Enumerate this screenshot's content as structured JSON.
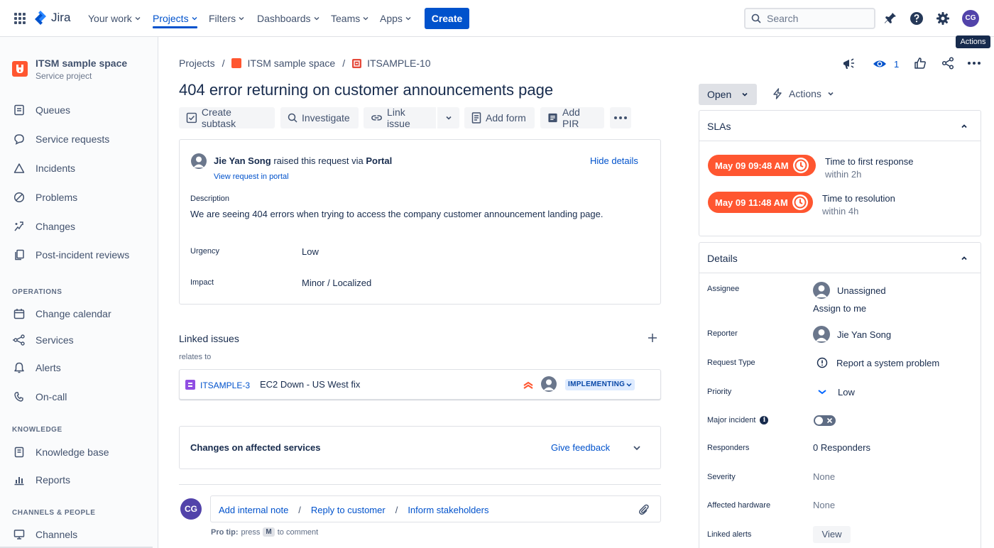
{
  "nav": {
    "app_name": "Jira",
    "items": [
      {
        "label": "Your work"
      },
      {
        "label": "Projects"
      },
      {
        "label": "Filters"
      },
      {
        "label": "Dashboards"
      },
      {
        "label": "Teams"
      },
      {
        "label": "Apps"
      }
    ],
    "create_label": "Create",
    "search_placeholder": "Search",
    "avatar_initials": "CG",
    "tooltip": "Actions"
  },
  "sidebar": {
    "project_name": "ITSM sample space",
    "project_type": "Service project",
    "items": [
      {
        "label": "Queues",
        "icon": "queues-icon"
      },
      {
        "label": "Service requests",
        "icon": "chat-icon"
      },
      {
        "label": "Incidents",
        "icon": "warning-triangle-icon"
      },
      {
        "label": "Problems",
        "icon": "blocked-icon"
      },
      {
        "label": "Changes",
        "icon": "changes-icon"
      },
      {
        "label": "Post-incident reviews",
        "icon": "copy-icon"
      }
    ],
    "section_operations": "OPERATIONS",
    "operations_items": [
      {
        "label": "Change calendar",
        "icon": "calendar-icon"
      },
      {
        "label": "Services",
        "icon": "services-icon"
      },
      {
        "label": "Alerts",
        "icon": "bell-icon"
      },
      {
        "label": "On-call",
        "icon": "on-call-icon"
      }
    ],
    "section_knowledge": "KNOWLEDGE",
    "knowledge_items": [
      {
        "label": "Knowledge base",
        "icon": "book-icon"
      },
      {
        "label": "Reports",
        "icon": "bar-chart-icon"
      }
    ],
    "section_channels": "CHANNELS & PEOPLE",
    "channels_items": [
      {
        "label": "Channels",
        "icon": "monitor-icon"
      }
    ]
  },
  "breadcrumb": {
    "projects": "Projects",
    "sep": "/",
    "project": "ITSM sample space",
    "issue": "ITSAMPLE-10"
  },
  "issue": {
    "title": "404 error returning on customer announcements page",
    "watchers": "1"
  },
  "toolbar": {
    "create_subtask": "Create subtask",
    "investigate": "Investigate",
    "link_issue": "Link issue",
    "add_form": "Add form",
    "add_pir": "Add PIR"
  },
  "request": {
    "reporter": "Jie Yan Song",
    "raised_text": "raised this request via",
    "channel": "Portal",
    "view_portal": "View request in portal",
    "hide_details": "Hide details",
    "description_label": "Description",
    "description": "We are seeing 404 errors when trying to access the company customer announcement landing page.",
    "urgency_label": "Urgency",
    "urgency": "Low",
    "impact_label": "Impact",
    "impact": "Minor / Localized"
  },
  "linked": {
    "title": "Linked issues",
    "relation": "relates to",
    "key": "ITSAMPLE-3",
    "summary": "EC2 Down - US West fix",
    "status": "IMPLEMENTING"
  },
  "changes": {
    "title": "Changes on affected services",
    "feedback": "Give feedback"
  },
  "comment": {
    "add_note": "Add internal note",
    "sep": "/",
    "reply": "Reply to customer",
    "inform": "Inform stakeholders",
    "protip_bold": "Pro tip:",
    "protip_press": "press",
    "protip_key": "M",
    "protip_rest": "to comment"
  },
  "status": {
    "current": "Open",
    "actions": "Actions"
  },
  "slas": {
    "title": "SLAs",
    "items": [
      {
        "time": "May 09 09:48 AM",
        "name": "Time to first response",
        "goal": "within 2h"
      },
      {
        "time": "May 09 11:48 AM",
        "name": "Time to resolution",
        "goal": "within 4h"
      }
    ],
    "color": "#ff5630"
  },
  "details": {
    "title": "Details",
    "assignee_label": "Assignee",
    "assignee": "Unassigned",
    "assign_to_me": "Assign to me",
    "reporter_label": "Reporter",
    "reporter": "Jie Yan Song",
    "request_type_label": "Request Type",
    "request_type": "Report a system problem",
    "priority_label": "Priority",
    "priority": "Low",
    "major_incident_label": "Major incident",
    "responders_label": "Responders",
    "responders": "0 Responders",
    "severity_label": "Severity",
    "severity": "None",
    "affected_hardware_label": "Affected hardware",
    "affected_hardware": "None",
    "linked_alerts_label": "Linked alerts",
    "view": "View"
  },
  "colors": {
    "brand": "#0052cc",
    "sla_breach": "#ff5630",
    "avatar": "#5243aa"
  }
}
